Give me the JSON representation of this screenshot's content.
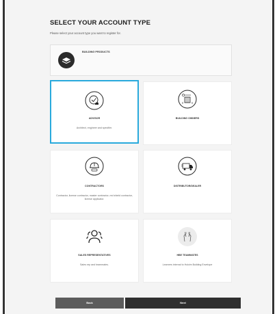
{
  "page": {
    "title": "SELECT YOUR ACCOUNT TYPE",
    "subtitle": "Please select your account type you want to register for."
  },
  "building_products": {
    "label": "BUILDING PRODUCTS",
    "icon": "layers-icon"
  },
  "account_types": [
    {
      "label": "ADVISOR",
      "description": "Architect, engineer and specifier.",
      "icon": "advisor-icon",
      "selected": true
    },
    {
      "label": "BUILDING OWNERS",
      "description": "",
      "icon": "building-owners-icon",
      "selected": false
    },
    {
      "label": "CONTRACTORS",
      "description": "Contractor, license contractor, master contractor, red shield contractor, license applicator.",
      "icon": "hard-hat-icon",
      "selected": false
    },
    {
      "label": "DISTRIBUTOR/DEALER",
      "description": "",
      "icon": "delivery-truck-icon",
      "selected": false
    },
    {
      "label": "SALES REPRESENTATIVES",
      "description": "Sales rep and teammates.",
      "icon": "team-icon",
      "selected": false
    },
    {
      "label": "HBE TEAMMATES",
      "description": "Learners internal to Holcim Building Envelope",
      "icon": "raised-hands-icon",
      "selected": false
    }
  ],
  "actions": {
    "back_label": "Back",
    "next_label": "Next"
  },
  "colors": {
    "selected_border": "#28a9dc",
    "back_button": "#5c5c5c",
    "next_button": "#2f2f2f"
  }
}
